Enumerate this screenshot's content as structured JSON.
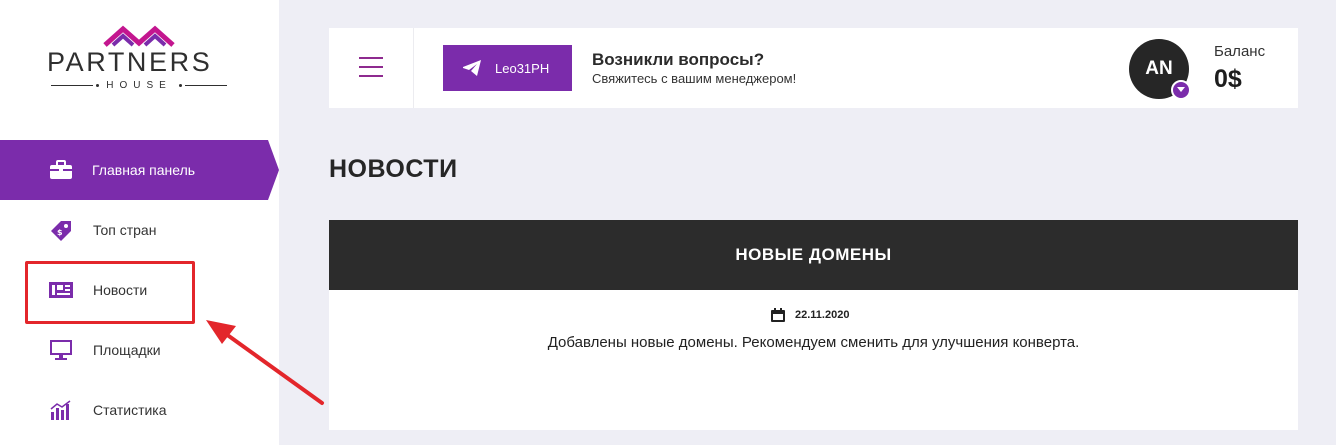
{
  "logo": {
    "word": "PARTNERS",
    "sub": "HOUSE"
  },
  "sidebar": {
    "items": [
      {
        "label": "Главная панель",
        "icon": "briefcase-icon",
        "active": true
      },
      {
        "label": "Топ стран",
        "icon": "price-tag-icon",
        "active": false
      },
      {
        "label": "Новости",
        "icon": "newspaper-icon",
        "active": false
      },
      {
        "label": "Площадки",
        "icon": "monitor-icon",
        "active": false
      },
      {
        "label": "Статистика",
        "icon": "bar-chart-icon",
        "active": false
      }
    ]
  },
  "header": {
    "telegram_label": "Leo31PH",
    "question_title": "Возникли вопросы?",
    "question_sub": "Свяжитесь с вашим менеджером!",
    "avatar_initials": "AN",
    "balance_label": "Баланс",
    "balance_value": "0$"
  },
  "main": {
    "title": "НОВОСТИ",
    "news": {
      "heading": "НОВЫЕ ДОМЕНЫ",
      "date": "22.11.2020",
      "text": "Добавлены новые домены. Рекомендуем сменить для улучшения конверта."
    }
  },
  "colors": {
    "accent": "#7b2cab",
    "background": "#eeeef5",
    "dark": "#2c2c2c",
    "annotation": "#e3262b"
  }
}
